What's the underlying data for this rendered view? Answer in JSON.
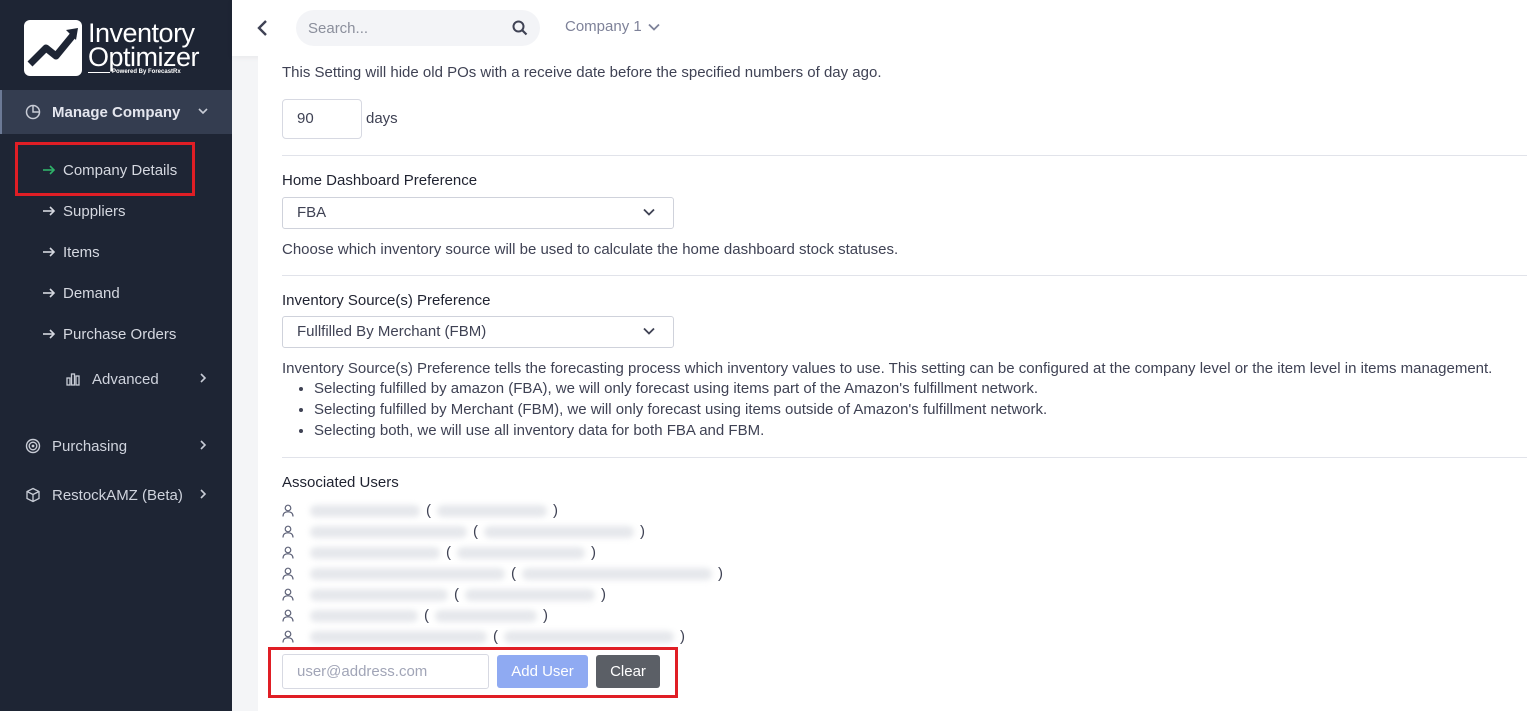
{
  "brand": {
    "line1": "Inventory",
    "line2": "Optimizer",
    "tagline": "Powered By ForecastRx"
  },
  "sidebar": {
    "manage_company": "Manage Company",
    "sub_items": [
      "Company Details",
      "Suppliers",
      "Items",
      "Demand",
      "Purchase Orders"
    ],
    "advanced": "Advanced",
    "purchasing": "Purchasing",
    "restock": "RestockAMZ (Beta)"
  },
  "topbar": {
    "search_placeholder": "Search...",
    "company": "Company 1"
  },
  "settings": {
    "old_po_desc": "This Setting will hide old POs with a receive date before the specified numbers of day ago.",
    "days_value": "90",
    "days_unit": "days",
    "home_dashboard_label": "Home Dashboard Preference",
    "home_dashboard_value": "FBA",
    "home_dashboard_desc": "Choose which inventory source will be used to calculate the home dashboard stock statuses.",
    "inventory_source_label": "Inventory Source(s) Preference",
    "inventory_source_value": "Fullfilled By Merchant (FBM)",
    "inventory_source_desc": "Inventory Source(s) Preference tells the forecasting process which inventory values to use. This setting can be configured at the company level or the item level in items management.",
    "bullets": [
      "Selecting fulfilled by amazon (FBA), we will only forecast using items part of the Amazon's fulfillment network.",
      "Selecting fulfilled by Merchant (FBM), we will only forecast using items outside of Amazon's fulfillment network.",
      "Selecting both, we will use all inventory data for both FBA and FBM."
    ]
  },
  "users": {
    "label": "Associated Users",
    "open_paren": "(",
    "close_paren": ")",
    "email_placeholder": "user@address.com",
    "add_label": "Add User",
    "clear_label": "Clear"
  },
  "colors": {
    "sidebar_bg": "#1e2534",
    "highlight": "#e01e25",
    "add_button": "#8faaf2",
    "clear_button": "#5b5f66",
    "current_arrow": "#2fb36a"
  }
}
